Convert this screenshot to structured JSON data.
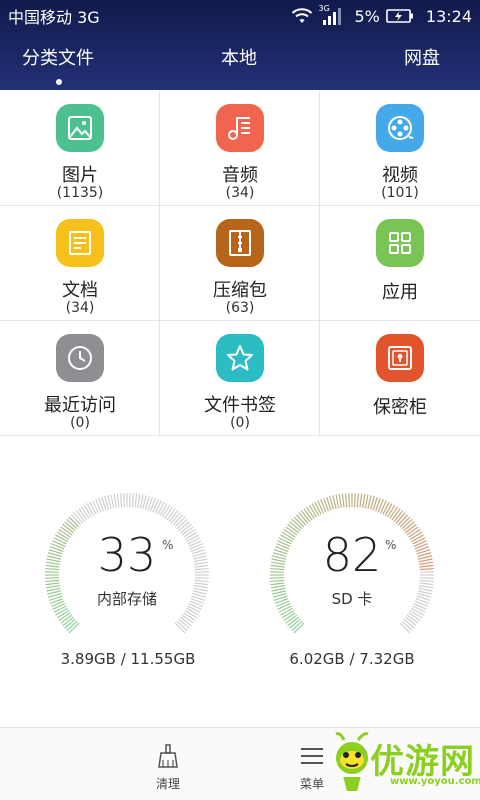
{
  "status": {
    "carrier": "中国移动 3G",
    "network_badge": "3G",
    "battery_percent": "5%",
    "time": "13:24"
  },
  "tabs": [
    {
      "label": "分类文件",
      "active": true
    },
    {
      "label": "本地",
      "active": false
    },
    {
      "label": "网盘",
      "active": false
    }
  ],
  "categories": [
    {
      "label": "图片",
      "count": "(1135)",
      "icon": "image-icon",
      "color": "#4cc08f"
    },
    {
      "label": "音频",
      "count": "(34)",
      "icon": "music-icon",
      "color": "#f0654f"
    },
    {
      "label": "视频",
      "count": "(101)",
      "icon": "video-icon",
      "color": "#45a8e8"
    },
    {
      "label": "文档",
      "count": "(34)",
      "icon": "document-icon",
      "color": "#f5c11a"
    },
    {
      "label": "压缩包",
      "count": "(63)",
      "icon": "zip-icon",
      "color": "#b8651c"
    },
    {
      "label": "应用",
      "count": "",
      "icon": "apps-icon",
      "color": "#78c454"
    },
    {
      "label": "最近访问",
      "count": "(0)",
      "icon": "clock-icon",
      "color": "#8e8e93"
    },
    {
      "label": "文件书签",
      "count": "(0)",
      "icon": "star-icon",
      "color": "#2cbcc4"
    },
    {
      "label": "保密柜",
      "count": "",
      "icon": "safe-icon",
      "color": "#e4542c"
    }
  ],
  "storage": {
    "internal": {
      "percent": "33",
      "percent_symbol": "%",
      "name": "内部存储",
      "usage": "3.89GB / 11.55GB",
      "fraction": 0.33
    },
    "sd": {
      "percent": "82",
      "percent_symbol": "%",
      "name": "SD 卡",
      "usage": "6.02GB / 7.32GB",
      "fraction": 0.82
    }
  },
  "bottombar": {
    "clean_label": "清理",
    "menu_label": "菜单"
  },
  "watermark": {
    "text": "优游网",
    "url": "www.yoyou.com"
  },
  "colors": {
    "header": "#1b2766",
    "gauge_used_start": "#8fd39a",
    "gauge_used_end": "#e88a6a",
    "gauge_free": "#cfcfcf",
    "watermark": "#8bd020"
  }
}
